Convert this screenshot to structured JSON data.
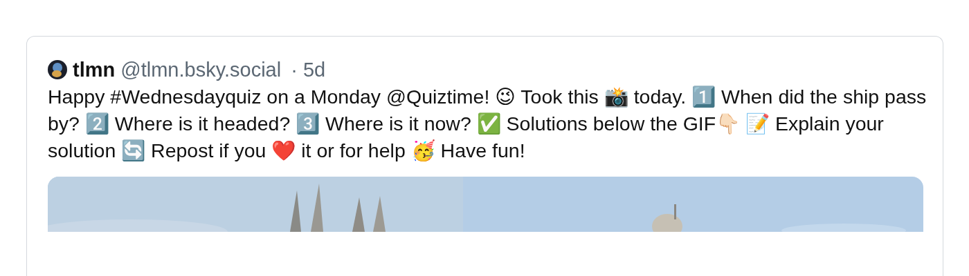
{
  "post": {
    "author": {
      "display_name": "tlmn",
      "handle": "@tlmn.bsky.social",
      "time": "· 5d"
    },
    "text": "Happy #Wednesdayquiz on a Monday @Quiztime! 😉 Took this 📸 today. 1️⃣ When did the ship pass by? 2️⃣ Where is it headed? 3️⃣ Where is it now? ✅ Solutions below the GIF👇🏻 📝 Explain your solution 🔄 Repost if you ❤️ it or for help 🥳 Have fun!"
  }
}
